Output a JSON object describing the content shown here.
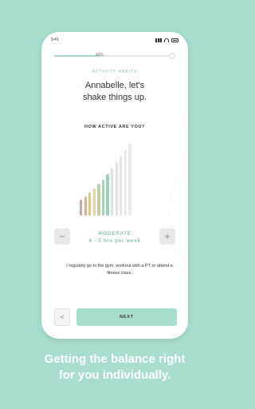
{
  "status_bar": {
    "time": "9:41"
  },
  "progress": {
    "label": "40%",
    "fraction": 0.4
  },
  "section_label": "ACTIVITY HABITS",
  "greeting": {
    "line1": "Annabelle, let's",
    "line2": "shake things up."
  },
  "question": "HOW ACTIVE ARE YOU?",
  "activity_scale": {
    "bars": [
      {
        "level": 0.22,
        "color": "#d6a39a"
      },
      {
        "level": 0.27,
        "color": "#dfb08c"
      },
      {
        "level": 0.32,
        "color": "#e6c48a"
      },
      {
        "level": 0.38,
        "color": "#ead49c"
      },
      {
        "level": 0.44,
        "color": "#b9d3a2"
      },
      {
        "level": 0.5,
        "color": "#a6d3b8"
      },
      {
        "level": 0.58,
        "color": "#9fcfbf"
      },
      {
        "level": 0.66,
        "color": "#dfdfdf"
      },
      {
        "level": 0.75,
        "color": "#e2e2e2"
      },
      {
        "level": 0.83,
        "color": "#e5e5e5"
      },
      {
        "level": 0.91,
        "color": "#e8e8e8"
      },
      {
        "level": 1.0,
        "color": "#ebebeb"
      }
    ],
    "selected_count": 7
  },
  "stepper": {
    "minus": "−",
    "plus": "+"
  },
  "selection": {
    "name": "MODERATE",
    "range": "4 - 5 hrs per week"
  },
  "description": "I regularly go to the gym, workout with a PT or attend a fitness class.",
  "nav": {
    "back": "<",
    "next": "NEXT"
  },
  "tagline": {
    "line1": "Getting the balance right",
    "line2": "for you individually."
  },
  "colors": {
    "background": "#a9ddd2",
    "accent": "#8dbfb2",
    "button": "#a9ddd2"
  }
}
